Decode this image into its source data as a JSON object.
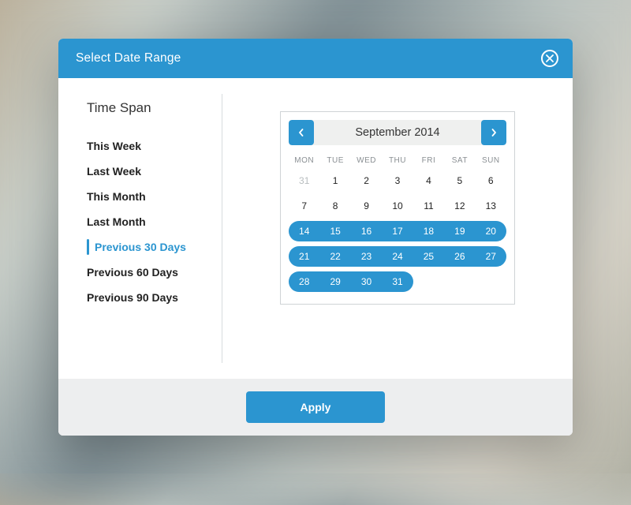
{
  "colors": {
    "accent": "#2b95d0"
  },
  "header": {
    "title": "Select Date Range"
  },
  "sidebar": {
    "title": "Time Span",
    "items": [
      {
        "label": "This Week",
        "selected": false
      },
      {
        "label": "Last Week",
        "selected": false
      },
      {
        "label": "This Month",
        "selected": false
      },
      {
        "label": "Last Month",
        "selected": false
      },
      {
        "label": "Previous 30 Days",
        "selected": true
      },
      {
        "label": "Previous 60 Days",
        "selected": false
      },
      {
        "label": "Previous 90 Days",
        "selected": false
      }
    ]
  },
  "calendar": {
    "month_label": "September 2014",
    "dow": [
      "MON",
      "TUE",
      "WED",
      "THU",
      "FRI",
      "SAT",
      "SUN"
    ],
    "leading_out": [
      31
    ],
    "days_in_month": 31,
    "selected_range": {
      "start": 14,
      "end": 31
    }
  },
  "footer": {
    "apply_label": "Apply"
  }
}
